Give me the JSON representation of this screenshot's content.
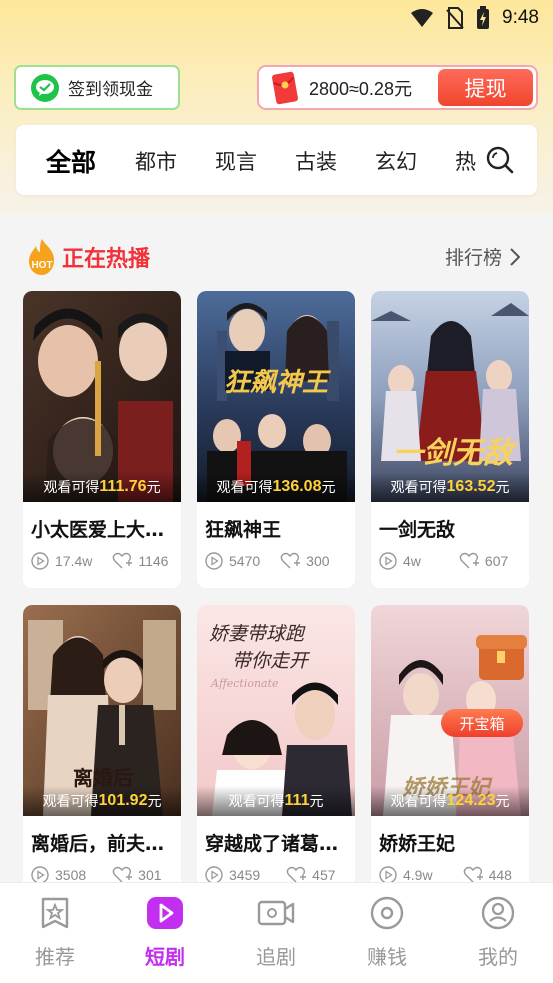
{
  "status_bar": {
    "time": "9:48"
  },
  "header": {
    "checkin_label": "签到领现金",
    "wallet_amount": "2800≈0.28元",
    "withdraw_label": "提现"
  },
  "categories": [
    "全部",
    "都市",
    "现言",
    "古装",
    "玄幻",
    "热"
  ],
  "section": {
    "hot_badge": "HOT",
    "title": "正在热播",
    "rank_label": "排行榜"
  },
  "reward_prefix": "观看可得",
  "reward_suffix": "元",
  "treasure_label": "开宝箱",
  "dramas": [
    {
      "title": "小太医爱上大…",
      "reward": "111.76",
      "views": "17.4w",
      "likes": "1146"
    },
    {
      "title": "狂飙神王",
      "reward": "136.08",
      "views": "5470",
      "likes": "300"
    },
    {
      "title": "一剑无敌",
      "reward": "163.52",
      "views": "4w",
      "likes": "607"
    },
    {
      "title": "离婚后，前夫…",
      "reward": "101.92",
      "views": "3508",
      "likes": "301"
    },
    {
      "title": "穿越成了诸葛…",
      "reward": "111",
      "views": "3459",
      "likes": "457"
    },
    {
      "title": "娇娇王妃",
      "reward": "124.23",
      "views": "4.9w",
      "likes": "448"
    }
  ],
  "bottom_nav": [
    {
      "label": "推荐",
      "icon": "recommend-icon"
    },
    {
      "label": "短剧",
      "icon": "short-drama-icon"
    },
    {
      "label": "追剧",
      "icon": "follow-drama-icon"
    },
    {
      "label": "赚钱",
      "icon": "earn-money-icon"
    },
    {
      "label": "我的",
      "icon": "profile-icon"
    }
  ],
  "colors": {
    "accent": "#c22ff0",
    "hot_red": "#f2313a",
    "reward_gold": "#ffd23a",
    "withdraw": "#f0452e"
  }
}
